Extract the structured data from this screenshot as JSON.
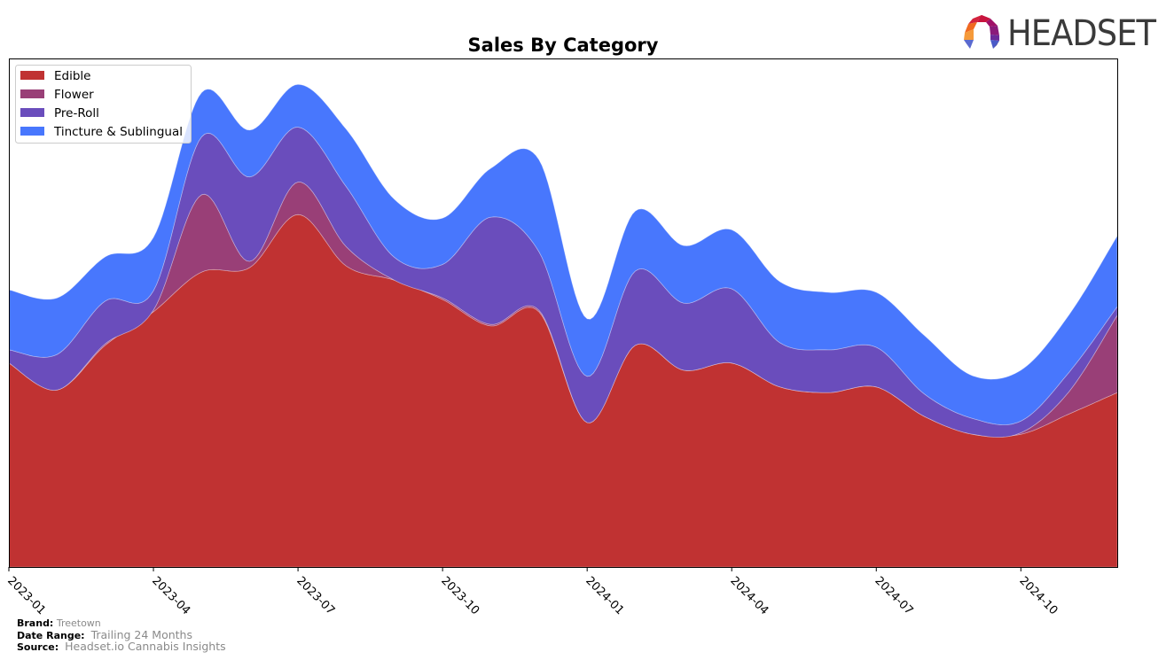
{
  "chart_data": {
    "type": "area",
    "stacked": true,
    "smoothed": true,
    "title": "Sales By Category",
    "xlabel": "",
    "ylabel": "",
    "y_units": "relative (percent of axis height; no y tick labels shown)",
    "ylim": [
      0,
      100
    ],
    "grid": false,
    "legend_position": "top-left",
    "x": [
      "2023-01",
      "2023-02",
      "2023-03",
      "2023-04",
      "2023-05",
      "2023-06",
      "2023-07",
      "2023-08",
      "2023-09",
      "2023-10",
      "2023-11",
      "2023-12",
      "2024-01",
      "2024-02",
      "2024-03",
      "2024-04",
      "2024-05",
      "2024-06",
      "2024-07",
      "2024-08",
      "2024-09",
      "2024-10",
      "2024-11",
      "2024-12"
    ],
    "x_ticks": [
      "2023-01",
      "2023-04",
      "2023-07",
      "2023-10",
      "2024-01",
      "2024-04",
      "2024-07",
      "2024-10"
    ],
    "series": [
      {
        "name": "Edible",
        "color": "#c03232",
        "values": [
          40.1,
          34.8,
          43.6,
          50.2,
          58.0,
          58.9,
          69.3,
          59.2,
          56.4,
          52.6,
          47.4,
          50.2,
          28.4,
          43.6,
          38.7,
          40.1,
          35.4,
          34.3,
          35.4,
          29.6,
          26.1,
          26.1,
          30.1,
          34.3
        ]
      },
      {
        "name": "Flower",
        "color": "#993f77",
        "values": [
          0,
          0,
          0.3,
          0.3,
          15.2,
          1.2,
          6.4,
          3.8,
          0,
          0.3,
          0.3,
          0.3,
          0,
          0,
          0,
          0,
          0,
          0,
          0,
          0,
          0,
          0.3,
          4.4,
          15.2
        ]
      },
      {
        "name": "Pre-Roll",
        "color": "#6a4dbc",
        "values": [
          2.6,
          7.0,
          8.4,
          3.8,
          11.4,
          16.6,
          10.8,
          11.8,
          4.5,
          6.6,
          21.1,
          11.5,
          9.1,
          14.6,
          13.2,
          14.6,
          8.7,
          8.4,
          7.8,
          4.4,
          3.1,
          2.3,
          3.8,
          1.7
        ]
      },
      {
        "name": "Tincture & Sublingual",
        "color": "#4877fd",
        "values": [
          11.8,
          11.1,
          8.7,
          10.5,
          8.7,
          9.2,
          8.4,
          11.3,
          11.4,
          9.1,
          9.6,
          18.1,
          11.3,
          11.8,
          11.3,
          11.6,
          12.0,
          11.3,
          10.8,
          11.5,
          8.4,
          10.0,
          11.3,
          13.9
        ]
      }
    ]
  },
  "footer": {
    "brand_label": "Brand:",
    "brand_value": "Treetown",
    "date_range_label": "Date Range:",
    "date_range_value": "Trailing 24 Months",
    "source_label": "Source:",
    "source_value": "Headset.io Cannabis Insights"
  },
  "logo": {
    "text": "HEADSET",
    "icon": "headset-logo-icon"
  }
}
